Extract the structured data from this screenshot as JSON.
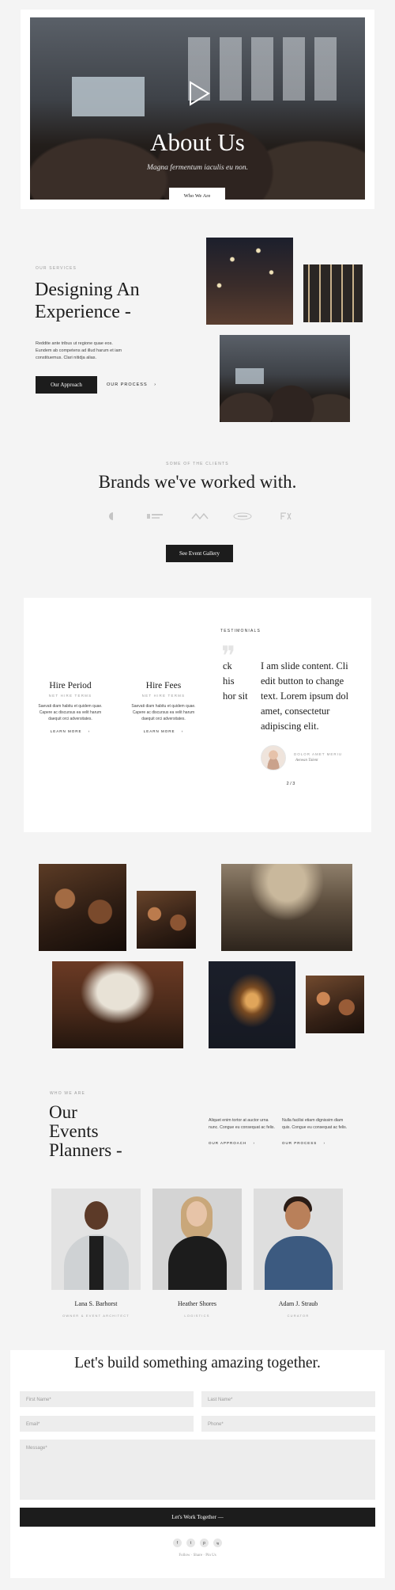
{
  "hero": {
    "title": "About Us",
    "subtitle": "Magna fermentum iaculis eu non.",
    "button": "Who We Are"
  },
  "services": {
    "eyebrow": "OUR SERVICES",
    "heading_line1": "Designing An",
    "heading_line2": "Experience -",
    "body_line1": "Reddite ante tribus ut regione quae eos.",
    "body_line2": "Eundem ab competens ad illud harum et iam",
    "body_line3": "constituemus. Clari nitidja alias.",
    "primary_button": "Our Approach",
    "secondary_link": "OUR PROCESS",
    "arrow": "›"
  },
  "clients": {
    "eyebrow": "SOME OF THE CLIENTS",
    "heading": "Brands we've worked with.",
    "button": "See Event Gallery"
  },
  "features": [
    {
      "title": "Hire Period",
      "eyebrow": "NET HIRE TERMS",
      "line1": "Saevati diam habitu et quidem quae.",
      "line2": "Capere ac discursus ea velit harum",
      "line3": "daequit orci adversitates.",
      "link": "LEARN MORE"
    },
    {
      "title": "Hire Fees",
      "eyebrow": "NET HIRE TERMS",
      "line1": "Saevati diam habitu et quidem quae.",
      "line2": "Capere ac discursus ea velit harum",
      "line3": "daequit orci adversitates.",
      "link": "LEARN MORE"
    }
  ],
  "testimonials": {
    "eyebrow": "TESTIMONIALS",
    "quote_mark": "❞",
    "partial_line1": "ck",
    "partial_line2": "his",
    "partial_line3": "hor sit",
    "line1": "I am slide content. Cli",
    "line2": "edit button to change",
    "line3": "text. Lorem ipsum dol",
    "line4": "amet, consectetur",
    "line5": "adipiscing elit.",
    "author_name": "Dolor Amet Meriu",
    "author_role": "Aenean Talent",
    "pager": "2 / 3"
  },
  "team_intro": {
    "eyebrow": "WHO WE ARE",
    "heading_line1": "Our",
    "heading_line2": "Events",
    "heading_line3": "Planners -",
    "col1_line1": "Aliquet enim tortor at auctor urna",
    "col1_line2": "nunc. Congue eu consequat ac felis.",
    "col1_link": "OUR APPROACH",
    "col2_line1": "Nulla facilisi etiam dignissim diam",
    "col2_line2": "quis. Congue eu consequat ac felis.",
    "col2_link": "OUR PROCESS"
  },
  "team": [
    {
      "name": "Lana S. Barhorst",
      "role": "OWNER & EVENT ARCHITECT"
    },
    {
      "name": "Heather Shores",
      "role": "LOGISTICS"
    },
    {
      "name": "Adam J. Straub",
      "role": "CURATOR"
    }
  ],
  "contact": {
    "heading": "Let's build something amazing together.",
    "first_name": "First Name*",
    "last_name": "Last Name*",
    "email": "Email*",
    "phone": "Phone*",
    "message": "Message*",
    "submit": "Let's Work Together —",
    "social": [
      "f",
      "t",
      "p",
      "ig"
    ],
    "follow": "Follow · Share · Pin Us"
  },
  "colors": {
    "dark": "#1c1c1c",
    "page_bg": "#f4f4f4",
    "card_bg": "#ffffff",
    "muted": "#9a9a9a"
  },
  "icons": {
    "play": "play-icon",
    "quote": "quote-icon",
    "arrow": "chevron-right-icon"
  }
}
